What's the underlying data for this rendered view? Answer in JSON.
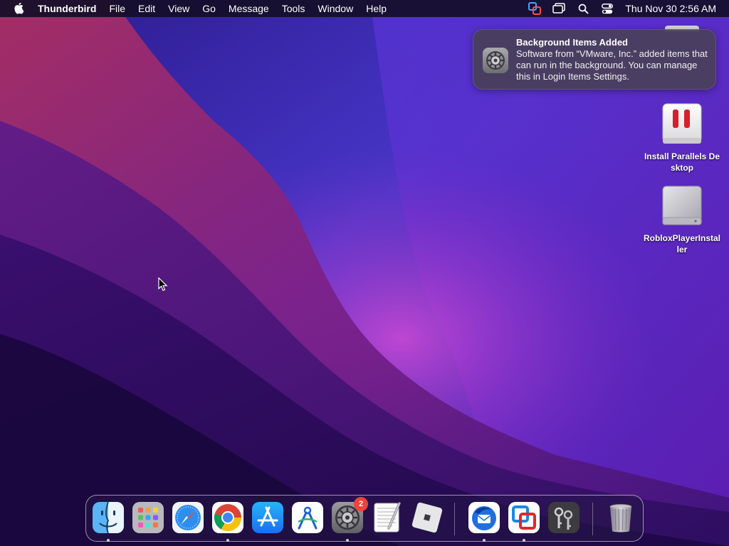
{
  "menubar": {
    "app_name": "Thunderbird",
    "menus": [
      "File",
      "Edit",
      "View",
      "Go",
      "Message",
      "Tools",
      "Window",
      "Help"
    ],
    "status_icons": [
      "vmware-fusion-icon",
      "screen-mirroring-icon",
      "spotlight-search-icon",
      "control-center-icon"
    ],
    "clock": "Thu Nov 30  2:56 AM"
  },
  "notification": {
    "title": "Background Items Added",
    "body": "Software from “VMware, Inc.” added items that can run in the background. You can manage this in Login Items Settings.",
    "icon": "system-settings-gear-icon"
  },
  "desktop_icons": [
    {
      "label": "Install Parallels Desktop",
      "icon": "parallels-installer-icon"
    },
    {
      "label": "RobloxPlayerInstaller",
      "icon": "disk-image-drive-icon"
    }
  ],
  "dock": {
    "apps": [
      {
        "name": "Finder",
        "icon": "finder-icon",
        "running": true
      },
      {
        "name": "Launchpad",
        "icon": "launchpad-icon",
        "running": false
      },
      {
        "name": "Safari",
        "icon": "safari-icon",
        "running": false
      },
      {
        "name": "Google Chrome",
        "icon": "chrome-icon",
        "running": true
      },
      {
        "name": "App Store",
        "icon": "app-store-icon",
        "running": false
      },
      {
        "name": "Instruments",
        "icon": "instruments-icon",
        "running": false
      },
      {
        "name": "System Settings",
        "icon": "system-settings-icon",
        "running": true,
        "badge": "2"
      },
      {
        "name": "TextEdit",
        "icon": "textedit-icon",
        "running": false
      },
      {
        "name": "Roblox",
        "icon": "roblox-icon",
        "running": false
      },
      {
        "name": "Thunderbird",
        "icon": "thunderbird-icon",
        "running": true
      },
      {
        "name": "VMware Fusion",
        "icon": "vmware-fusion-icon",
        "running": true
      },
      {
        "name": "Keychain Access",
        "icon": "keychain-access-icon",
        "running": false
      },
      {
        "name": "Trash",
        "icon": "trash-icon",
        "running": false
      }
    ]
  },
  "colors": {
    "accent_badge": "#f0423a",
    "wallpaper_deep": "#2a0f5e",
    "wallpaper_magenta": "#a02a8a",
    "wallpaper_blue": "#4a3fd8"
  }
}
